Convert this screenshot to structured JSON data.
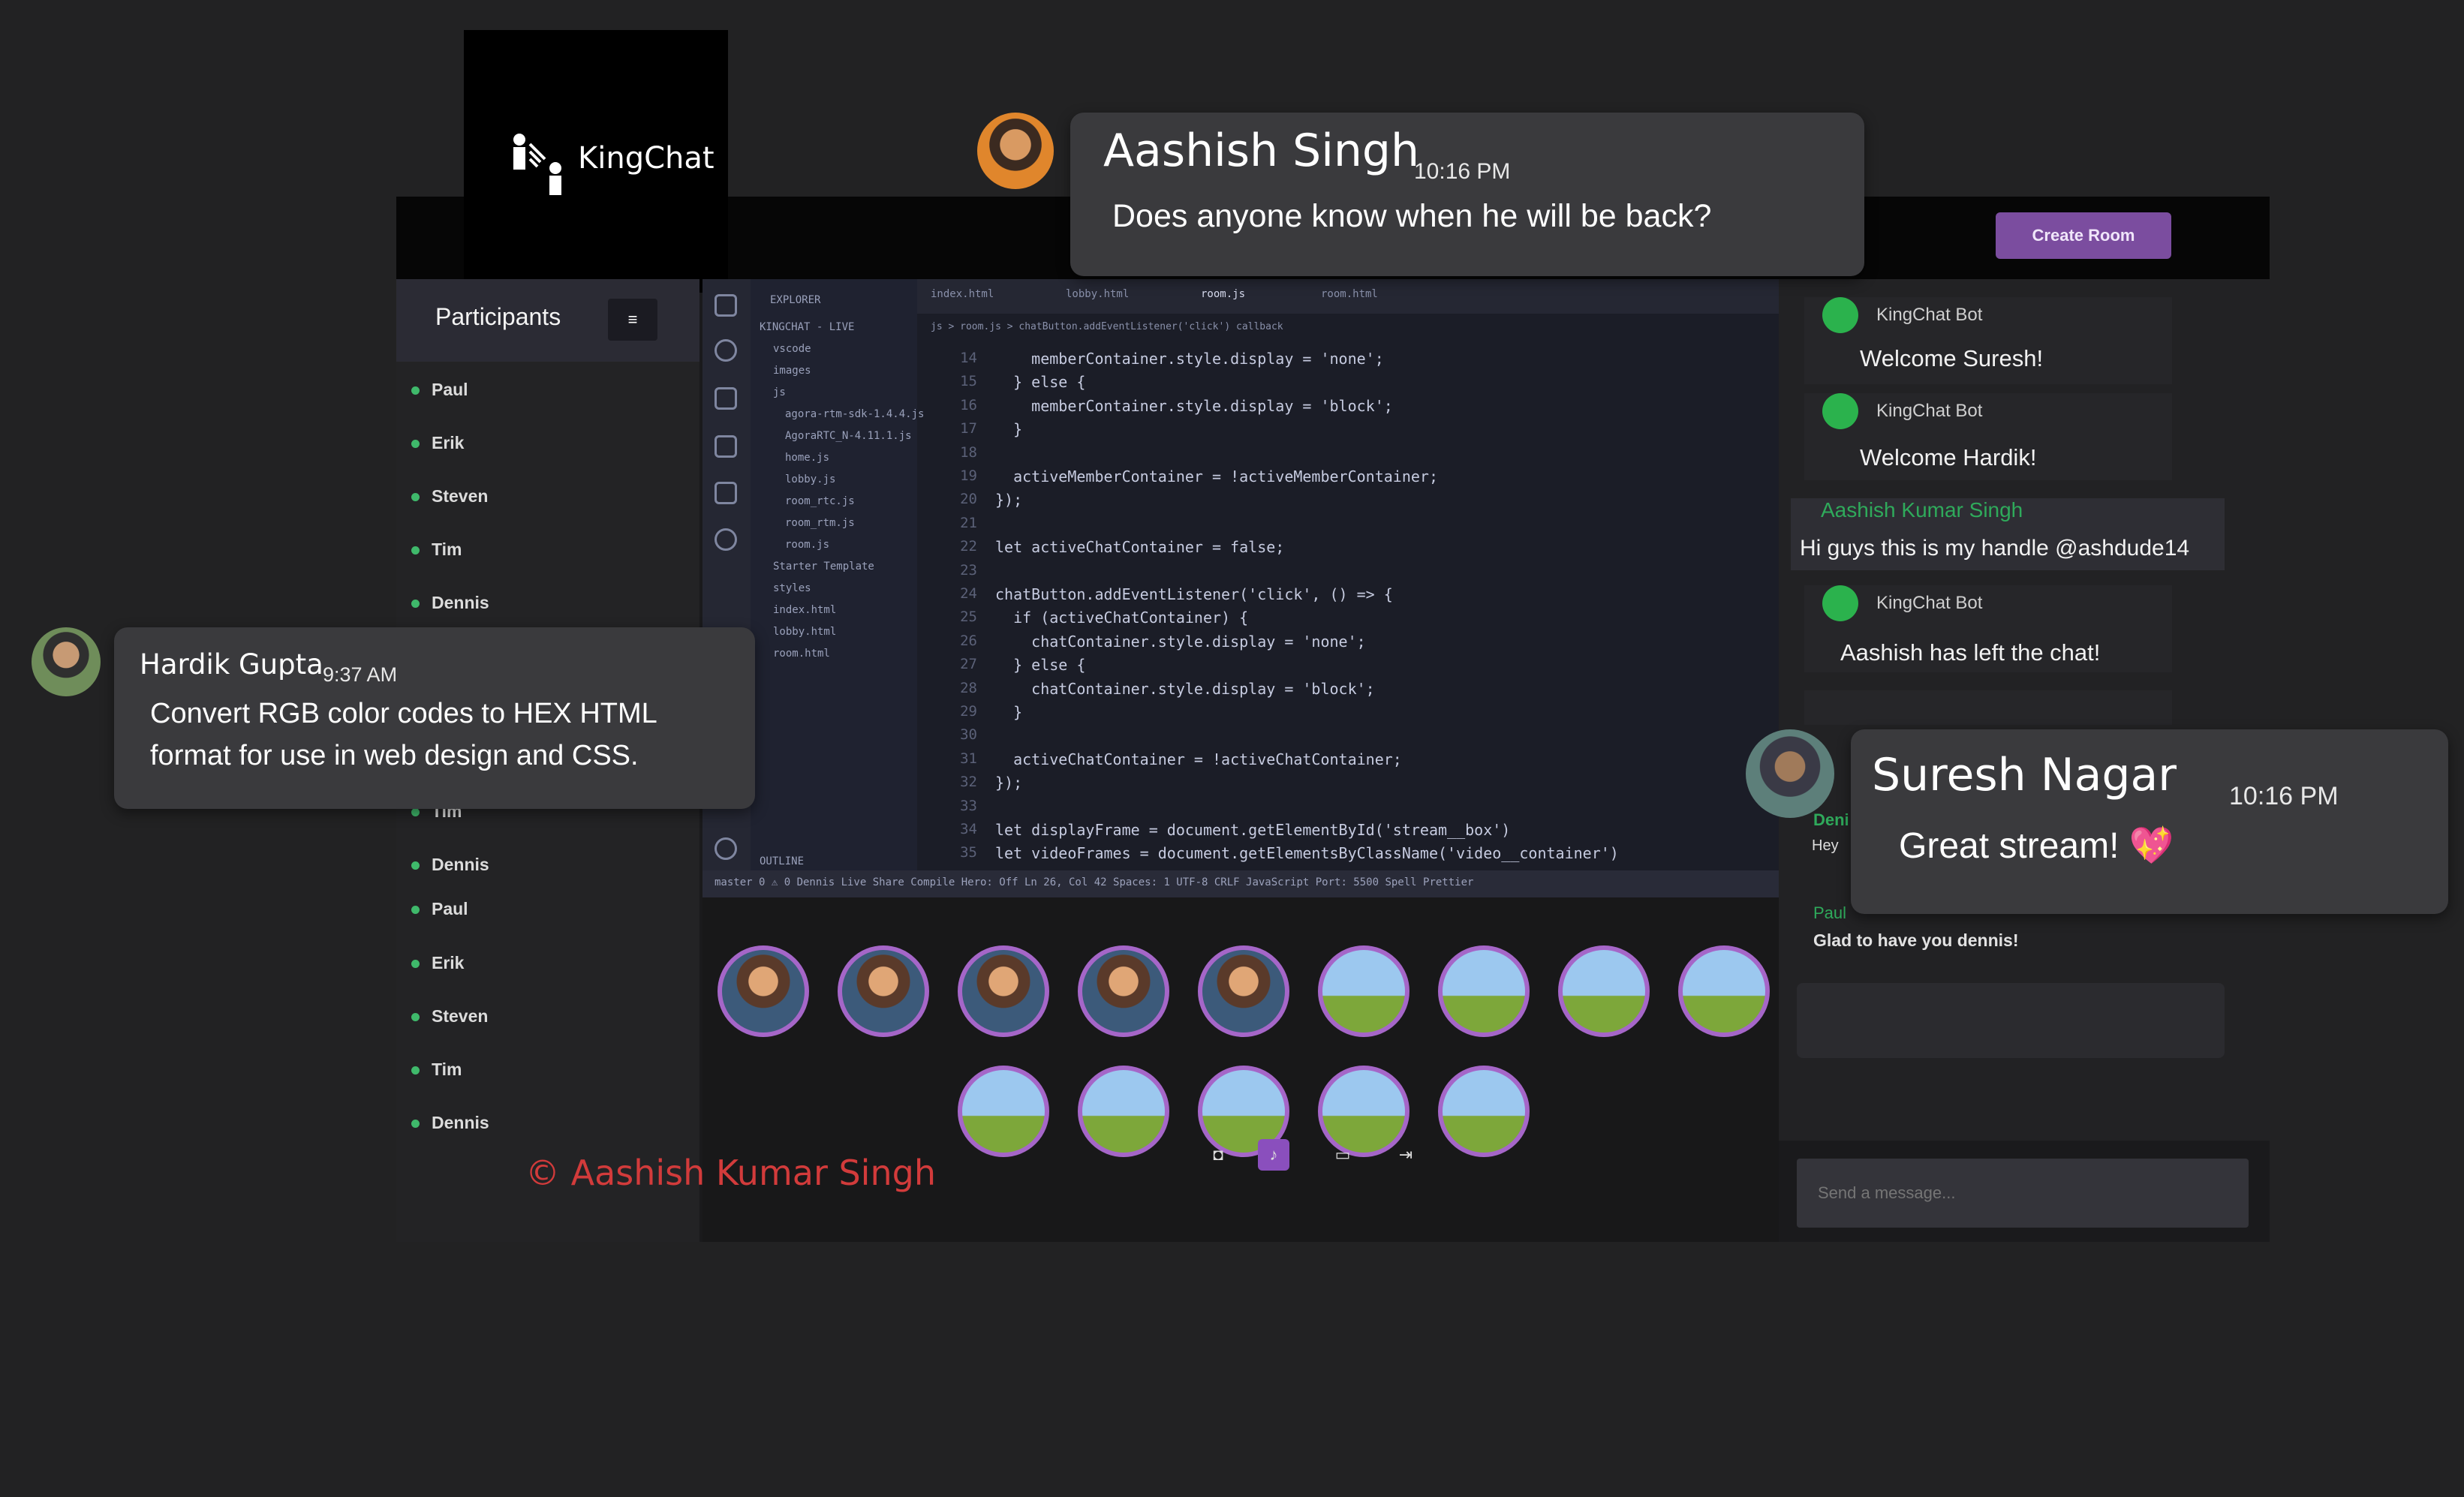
{
  "app": {
    "logo_text": "KingChat",
    "create_room_label": "Create Room"
  },
  "participants": {
    "title": "Participants",
    "count_icon": "menu-icon",
    "items": [
      "Paul",
      "Erik",
      "Steven",
      "Tim",
      "Dennis",
      "Tim",
      "Dennis",
      "Paul",
      "Erik",
      "Steven",
      "Tim",
      "Dennis"
    ]
  },
  "editor": {
    "explorer_title": "EXPLORER",
    "explorer_items": [
      "KINGCHAT - LIVE",
      "vscode",
      "images",
      "js",
      "agora-rtm-sdk-1.4.4.js",
      "AgoraRTC_N-4.11.1.js",
      "home.js",
      "lobby.js",
      "room_rtc.js",
      "room_rtm.js",
      "room.js",
      "Starter Template",
      "styles",
      "index.html",
      "lobby.html",
      "room.html"
    ],
    "outline_label": "OUTLINE",
    "tabs": [
      "index.html",
      "lobby.html",
      "room.js",
      "room.html"
    ],
    "breadcrumb": "js > room.js > chatButton.addEventListener('click') callback",
    "line_numbers": [
      "14",
      "15",
      "16",
      "17",
      "18",
      "19",
      "20",
      "21",
      "22",
      "23",
      "24",
      "25",
      "26",
      "27",
      "28",
      "29",
      "30",
      "31",
      "32",
      "33",
      "34",
      "35"
    ],
    "code_lines": [
      "    memberContainer.style.display = 'none';",
      "  } else {",
      "    memberContainer.style.display = 'block';",
      "  }",
      "",
      "  activeMemberContainer = !activeMemberContainer;",
      "});",
      "",
      "let activeChatContainer = false;",
      "",
      "chatButton.addEventListener('click', () => {",
      "  if (activeChatContainer) {",
      "    chatContainer.style.display = 'none';",
      "  } else {",
      "    chatContainer.style.display = 'block';",
      "  }",
      "",
      "  activeChatContainer = !activeChatContainer;",
      "});",
      "",
      "let displayFrame = document.getElementById('stream__box')",
      "let videoFrames = document.getElementsByClassName('video__container')"
    ],
    "status_bar": "master   0 ⚠ 0   Dennis   Live Share   Compile Hero: Off   Ln 26, Col 42   Spaces: 1   UTF-8   CRLF   JavaScript   Port: 5500   Spell   Prettier"
  },
  "video_controls": [
    "camera-icon",
    "mic-icon",
    "screen-share-icon",
    "leave-icon"
  ],
  "copyright": "© Aashish Kumar Singh",
  "chat": {
    "messages": [
      {
        "name": "KingChat Bot",
        "text": "Welcome Suresh!"
      },
      {
        "name": "KingChat Bot",
        "text": "Welcome Hardik!"
      },
      {
        "name": "Aashish Kumar Singh",
        "text": "Hi guys this is my handle @ashdude14"
      },
      {
        "name": "KingChat Bot",
        "text": "Aashish has left the  chat!"
      }
    ],
    "partial_name": "Deni",
    "partial_text": "Hey",
    "paul_name": "Paul",
    "paul_text": "Glad to have you dennis!",
    "send_placeholder": "Send a message..."
  },
  "bubbles": {
    "aashish": {
      "name": "Aashish Singh",
      "time": "10:16 PM",
      "text": "Does anyone know when he will be back?"
    },
    "hardik": {
      "name": "Hardik Gupta",
      "time": "9:37 AM",
      "text_line1": "Convert RGB color codes to HEX HTML",
      "text_line2": "format for use in web design and CSS."
    },
    "suresh": {
      "name": "Suresh Nagar",
      "time": "10:16 PM",
      "text": "Great stream! 💖"
    }
  },
  "colors": {
    "accent": "#a566c8",
    "create_room": "#7b4d9f",
    "online": "#3fb96b",
    "bot": "#2bb24d",
    "copyright": "#d23b3b"
  }
}
